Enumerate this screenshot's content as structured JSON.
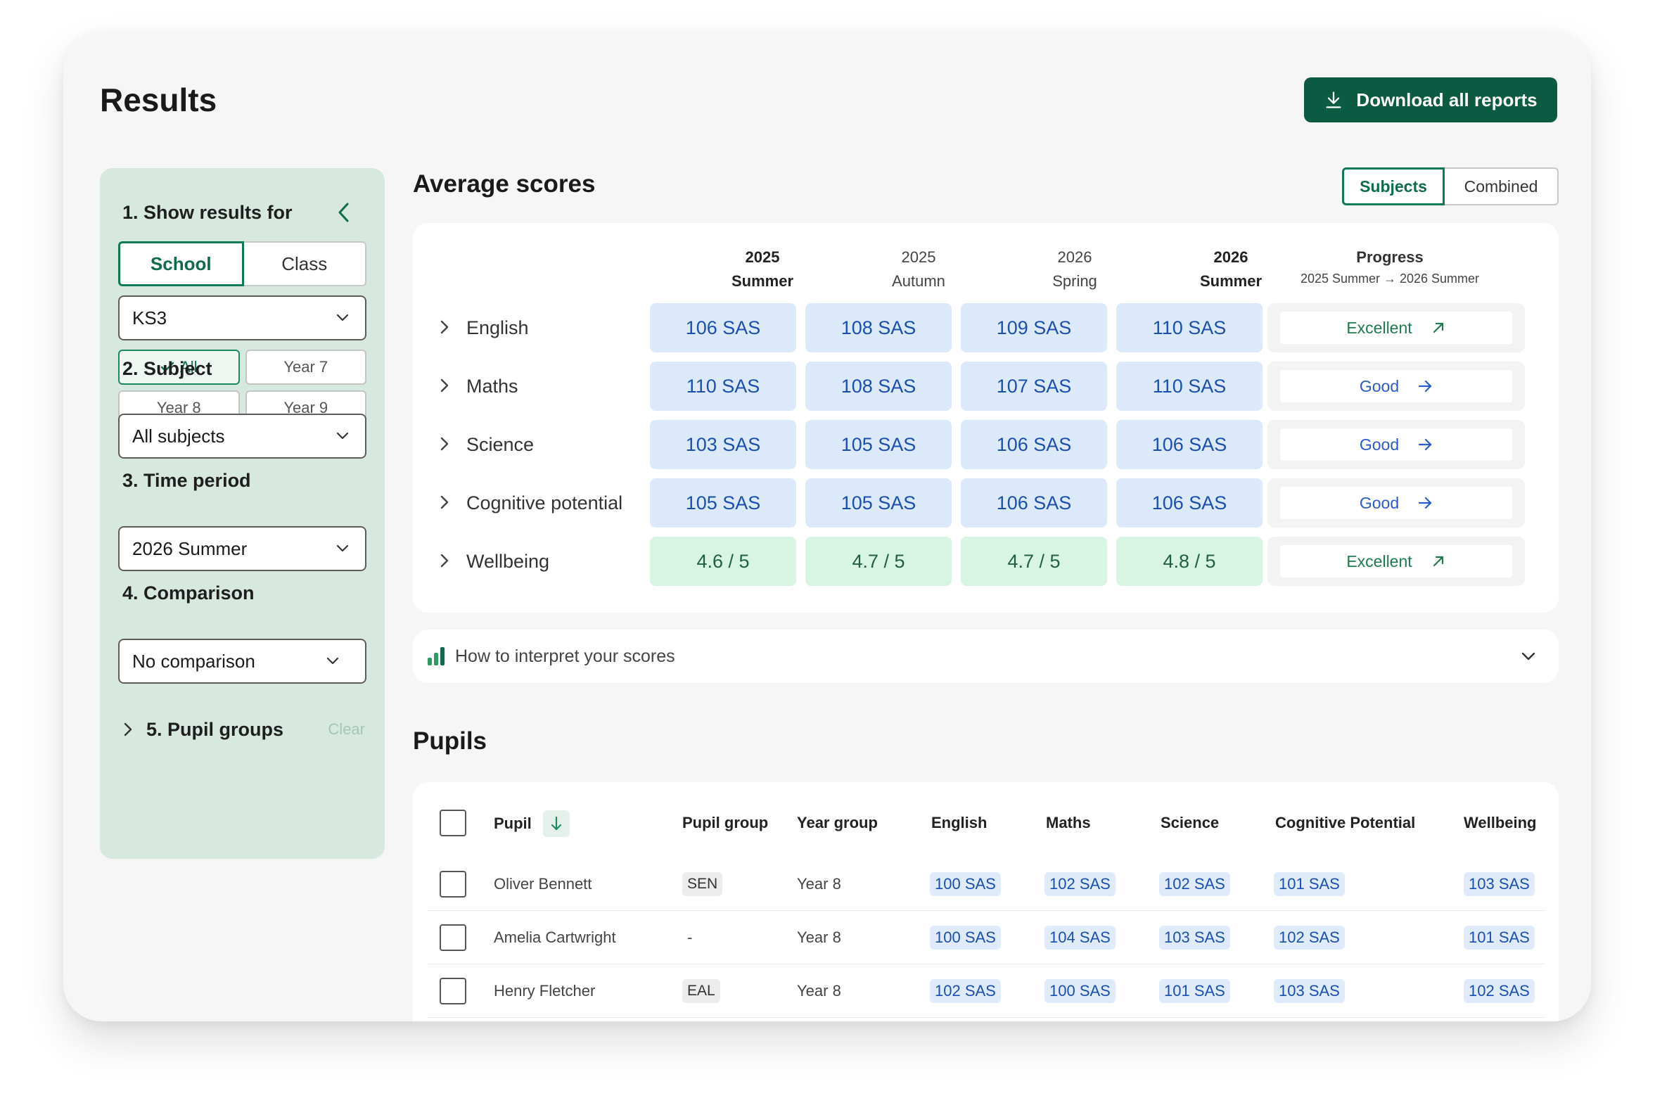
{
  "page": {
    "title": "Results",
    "download_label": "Download all reports"
  },
  "sidebar": {
    "show_results_title": "1. Show results for",
    "scope_options": [
      "School",
      "Class"
    ],
    "key_stage": "KS3",
    "year_chips": [
      "All",
      "Year 7",
      "Year 8",
      "Year 9"
    ],
    "subject_title": "2. Subject",
    "subject_value": "All subjects",
    "time_title": "3. Time period",
    "time_value": "2026 Summer",
    "comparison_title": "4. Comparison",
    "comparison_value": "No comparison",
    "groups_title": "5. Pupil groups",
    "clear_label": "Clear"
  },
  "average": {
    "title": "Average scores",
    "view_options": [
      "Subjects",
      "Combined"
    ],
    "columns": [
      {
        "year": "2025",
        "term": "Summer"
      },
      {
        "year": "2025",
        "term": "Autumn"
      },
      {
        "year": "2026",
        "term": "Spring"
      },
      {
        "year": "2026",
        "term": "Summer"
      }
    ],
    "progress_title": "Progress",
    "progress_subtitle": "2025 Summer → 2026 Summer",
    "rows": [
      {
        "name": "English",
        "values": [
          "106 SAS",
          "108 SAS",
          "109 SAS",
          "110 SAS"
        ],
        "progress": "Excellent",
        "trend": "up"
      },
      {
        "name": "Maths",
        "values": [
          "110 SAS",
          "108 SAS",
          "107 SAS",
          "110 SAS"
        ],
        "progress": "Good",
        "trend": "right"
      },
      {
        "name": "Science",
        "values": [
          "103 SAS",
          "105 SAS",
          "106 SAS",
          "106 SAS"
        ],
        "progress": "Good",
        "trend": "right"
      },
      {
        "name": "Cognitive potential",
        "values": [
          "105 SAS",
          "105 SAS",
          "106 SAS",
          "106 SAS"
        ],
        "progress": "Good",
        "trend": "right"
      },
      {
        "name": "Wellbeing",
        "values": [
          "4.6 / 5",
          "4.7 / 5",
          "4.7 / 5",
          "4.8 / 5"
        ],
        "progress": "Excellent",
        "trend": "up"
      }
    ],
    "interpret_label": "How to interpret your scores"
  },
  "pupils": {
    "title": "Pupils",
    "headers": [
      "Pupil",
      "Pupil group",
      "Year group",
      "English",
      "Maths",
      "Science",
      "Cognitive Potential",
      "Wellbeing"
    ],
    "rows": [
      {
        "name": "Oliver Bennett",
        "group": "SEN",
        "year": "Year 8",
        "english": "100 SAS",
        "maths": "102 SAS",
        "science": "102 SAS",
        "cognitive": "101 SAS",
        "wellbeing": "103 SAS"
      },
      {
        "name": "Amelia Cartwright",
        "group": "-",
        "year": "Year 8",
        "english": "100 SAS",
        "maths": "104 SAS",
        "science": "103 SAS",
        "cognitive": "102 SAS",
        "wellbeing": "101 SAS"
      },
      {
        "name": "Henry Fletcher",
        "group": "EAL",
        "year": "Year 8",
        "english": "102 SAS",
        "maths": "100 SAS",
        "science": "101 SAS",
        "cognitive": "103 SAS",
        "wellbeing": "102 SAS"
      }
    ]
  },
  "colors": {
    "brand_green": "#0b5a42",
    "score_blue": "#dce9fb",
    "wellbeing_green": "#d8f5e4",
    "sidebar_bg": "#d7e8df"
  }
}
